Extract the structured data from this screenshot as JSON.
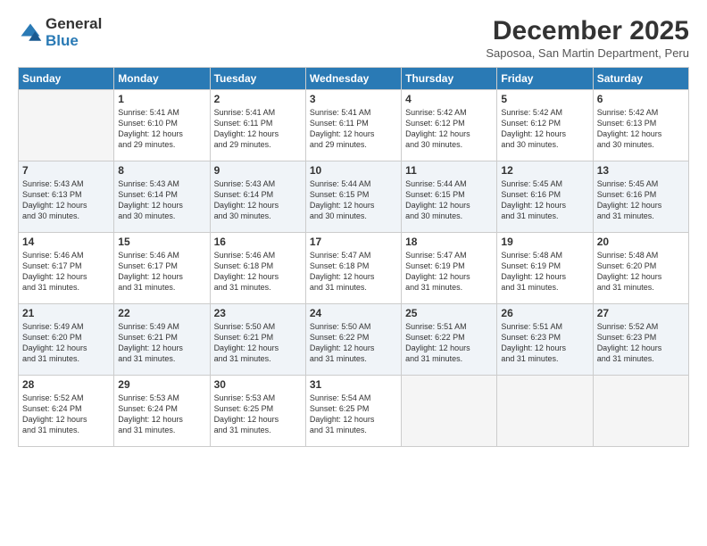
{
  "logo": {
    "general": "General",
    "blue": "Blue"
  },
  "title": "December 2025",
  "subtitle": "Saposoa, San Martin Department, Peru",
  "weekdays": [
    "Sunday",
    "Monday",
    "Tuesday",
    "Wednesday",
    "Thursday",
    "Friday",
    "Saturday"
  ],
  "weeks": [
    [
      {
        "day": null,
        "info": null
      },
      {
        "day": "1",
        "info": "Sunrise: 5:41 AM\nSunset: 6:10 PM\nDaylight: 12 hours\nand 29 minutes."
      },
      {
        "day": "2",
        "info": "Sunrise: 5:41 AM\nSunset: 6:11 PM\nDaylight: 12 hours\nand 29 minutes."
      },
      {
        "day": "3",
        "info": "Sunrise: 5:41 AM\nSunset: 6:11 PM\nDaylight: 12 hours\nand 29 minutes."
      },
      {
        "day": "4",
        "info": "Sunrise: 5:42 AM\nSunset: 6:12 PM\nDaylight: 12 hours\nand 30 minutes."
      },
      {
        "day": "5",
        "info": "Sunrise: 5:42 AM\nSunset: 6:12 PM\nDaylight: 12 hours\nand 30 minutes."
      },
      {
        "day": "6",
        "info": "Sunrise: 5:42 AM\nSunset: 6:13 PM\nDaylight: 12 hours\nand 30 minutes."
      }
    ],
    [
      {
        "day": "7",
        "info": "Sunrise: 5:43 AM\nSunset: 6:13 PM\nDaylight: 12 hours\nand 30 minutes."
      },
      {
        "day": "8",
        "info": "Sunrise: 5:43 AM\nSunset: 6:14 PM\nDaylight: 12 hours\nand 30 minutes."
      },
      {
        "day": "9",
        "info": "Sunrise: 5:43 AM\nSunset: 6:14 PM\nDaylight: 12 hours\nand 30 minutes."
      },
      {
        "day": "10",
        "info": "Sunrise: 5:44 AM\nSunset: 6:15 PM\nDaylight: 12 hours\nand 30 minutes."
      },
      {
        "day": "11",
        "info": "Sunrise: 5:44 AM\nSunset: 6:15 PM\nDaylight: 12 hours\nand 30 minutes."
      },
      {
        "day": "12",
        "info": "Sunrise: 5:45 AM\nSunset: 6:16 PM\nDaylight: 12 hours\nand 31 minutes."
      },
      {
        "day": "13",
        "info": "Sunrise: 5:45 AM\nSunset: 6:16 PM\nDaylight: 12 hours\nand 31 minutes."
      }
    ],
    [
      {
        "day": "14",
        "info": "Sunrise: 5:46 AM\nSunset: 6:17 PM\nDaylight: 12 hours\nand 31 minutes."
      },
      {
        "day": "15",
        "info": "Sunrise: 5:46 AM\nSunset: 6:17 PM\nDaylight: 12 hours\nand 31 minutes."
      },
      {
        "day": "16",
        "info": "Sunrise: 5:46 AM\nSunset: 6:18 PM\nDaylight: 12 hours\nand 31 minutes."
      },
      {
        "day": "17",
        "info": "Sunrise: 5:47 AM\nSunset: 6:18 PM\nDaylight: 12 hours\nand 31 minutes."
      },
      {
        "day": "18",
        "info": "Sunrise: 5:47 AM\nSunset: 6:19 PM\nDaylight: 12 hours\nand 31 minutes."
      },
      {
        "day": "19",
        "info": "Sunrise: 5:48 AM\nSunset: 6:19 PM\nDaylight: 12 hours\nand 31 minutes."
      },
      {
        "day": "20",
        "info": "Sunrise: 5:48 AM\nSunset: 6:20 PM\nDaylight: 12 hours\nand 31 minutes."
      }
    ],
    [
      {
        "day": "21",
        "info": "Sunrise: 5:49 AM\nSunset: 6:20 PM\nDaylight: 12 hours\nand 31 minutes."
      },
      {
        "day": "22",
        "info": "Sunrise: 5:49 AM\nSunset: 6:21 PM\nDaylight: 12 hours\nand 31 minutes."
      },
      {
        "day": "23",
        "info": "Sunrise: 5:50 AM\nSunset: 6:21 PM\nDaylight: 12 hours\nand 31 minutes."
      },
      {
        "day": "24",
        "info": "Sunrise: 5:50 AM\nSunset: 6:22 PM\nDaylight: 12 hours\nand 31 minutes."
      },
      {
        "day": "25",
        "info": "Sunrise: 5:51 AM\nSunset: 6:22 PM\nDaylight: 12 hours\nand 31 minutes."
      },
      {
        "day": "26",
        "info": "Sunrise: 5:51 AM\nSunset: 6:23 PM\nDaylight: 12 hours\nand 31 minutes."
      },
      {
        "day": "27",
        "info": "Sunrise: 5:52 AM\nSunset: 6:23 PM\nDaylight: 12 hours\nand 31 minutes."
      }
    ],
    [
      {
        "day": "28",
        "info": "Sunrise: 5:52 AM\nSunset: 6:24 PM\nDaylight: 12 hours\nand 31 minutes."
      },
      {
        "day": "29",
        "info": "Sunrise: 5:53 AM\nSunset: 6:24 PM\nDaylight: 12 hours\nand 31 minutes."
      },
      {
        "day": "30",
        "info": "Sunrise: 5:53 AM\nSunset: 6:25 PM\nDaylight: 12 hours\nand 31 minutes."
      },
      {
        "day": "31",
        "info": "Sunrise: 5:54 AM\nSunset: 6:25 PM\nDaylight: 12 hours\nand 31 minutes."
      },
      {
        "day": null,
        "info": null
      },
      {
        "day": null,
        "info": null
      },
      {
        "day": null,
        "info": null
      }
    ]
  ]
}
